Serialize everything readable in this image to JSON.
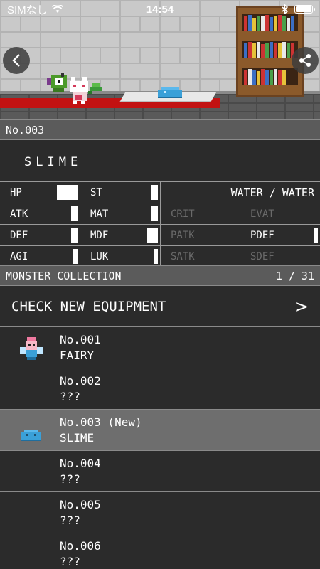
{
  "status_bar": {
    "carrier": "SIMなし",
    "time": "14:54"
  },
  "monster_detail": {
    "number": "No.003",
    "name": "SLIME",
    "element": "WATER / WATER",
    "stats_left": [
      {
        "label": "HP",
        "level": 0.32
      },
      {
        "label": "ATK",
        "level": 0.1
      },
      {
        "label": "DEF",
        "level": 0.1
      },
      {
        "label": "AGI",
        "level": 0.06
      }
    ],
    "stats_mid": [
      {
        "label": "ST",
        "level": 0.1
      },
      {
        "label": "MAT",
        "level": 0.1
      },
      {
        "label": "MDF",
        "level": 0.16
      },
      {
        "label": "LUK",
        "level": 0.05
      }
    ],
    "stats_right_a": [
      {
        "label": "CRIT",
        "dim": true
      },
      {
        "label": "PATK",
        "dim": true
      },
      {
        "label": "SATK",
        "dim": true
      }
    ],
    "stats_right_b": [
      {
        "label": "EVAT",
        "dim": true
      },
      {
        "label": "PDEF",
        "dim": false,
        "level": 0.06
      },
      {
        "label": "SDEF",
        "dim": true
      }
    ]
  },
  "collection": {
    "title": "MONSTER COLLECTION",
    "count": "1 / 31",
    "check_label": "CHECK NEW EQUIPMENT",
    "check_chevron": ">",
    "items": [
      {
        "number": "No.001",
        "name": "FAIRY",
        "icon": "fairy-icon",
        "selected": false
      },
      {
        "number": "No.002",
        "name": "???",
        "icon": "",
        "selected": false
      },
      {
        "number": "No.003  (New)",
        "name": "SLIME",
        "icon": "slime-icon",
        "selected": true
      },
      {
        "number": "No.004",
        "name": "???",
        "icon": "",
        "selected": false
      },
      {
        "number": "No.005",
        "name": "???",
        "icon": "",
        "selected": false
      },
      {
        "number": "No.006",
        "name": "???",
        "icon": "",
        "selected": false
      }
    ]
  },
  "colors": {
    "accent_red": "#c21212",
    "slime_blue": "#3aa0d8",
    "header_gray": "#5b5b5b",
    "selected_gray": "#6e6e6e"
  }
}
